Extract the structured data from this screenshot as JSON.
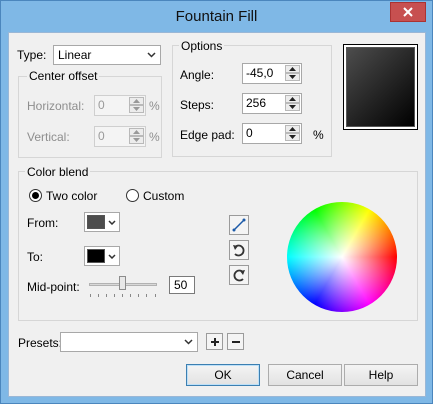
{
  "window": {
    "title": "Fountain Fill"
  },
  "type": {
    "label": "Type:",
    "value": "Linear"
  },
  "center_offset": {
    "legend": "Center offset",
    "horizontal": {
      "label": "Horizontal:",
      "value": "0",
      "unit": "%"
    },
    "vertical": {
      "label": "Vertical:",
      "value": "0",
      "unit": "%"
    }
  },
  "options": {
    "legend": "Options",
    "angle": {
      "label": "Angle:",
      "value": "-45,0"
    },
    "steps": {
      "label": "Steps:",
      "value": "256"
    },
    "edge_pad": {
      "label": "Edge pad:",
      "value": "0",
      "unit": "%"
    }
  },
  "color_blend": {
    "legend": "Color blend",
    "two_color": "Two color",
    "custom": "Custom",
    "from_label": "From:",
    "to_label": "To:",
    "midpoint_label": "Mid-point:",
    "midpoint_value": "50",
    "from_color": "#4d4d4d",
    "to_color": "#000000",
    "selected_mode": "Two color"
  },
  "presets": {
    "label": "Presets:",
    "value": ""
  },
  "buttons": {
    "ok": "OK",
    "cancel": "Cancel",
    "help": "Help"
  }
}
